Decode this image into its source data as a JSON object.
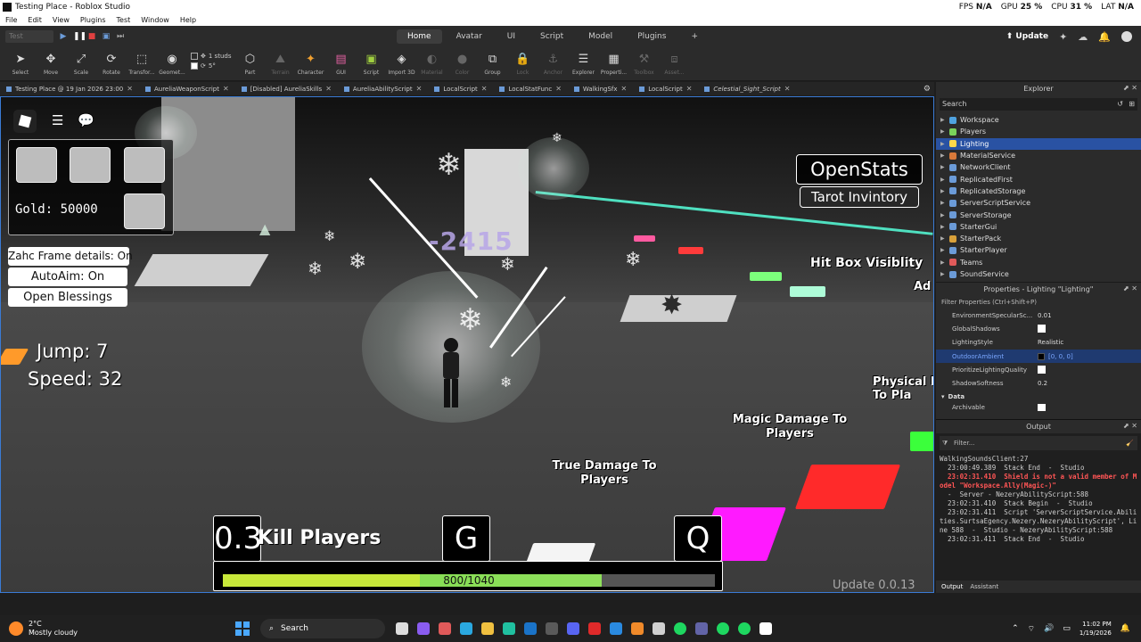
{
  "window": {
    "title": "Testing Place - Roblox Studio",
    "stats": [
      {
        "label": "FPS",
        "value": "N/A"
      },
      {
        "label": "GPU",
        "value": "25 %"
      },
      {
        "label": "CPU",
        "value": "31 %"
      },
      {
        "label": "LAT",
        "value": "N/A"
      }
    ]
  },
  "menu": [
    "File",
    "Edit",
    "View",
    "Plugins",
    "Test",
    "Window",
    "Help"
  ],
  "ribbon": {
    "test_select": "Test",
    "tabs": [
      {
        "label": "Home",
        "active": true
      },
      {
        "label": "Avatar",
        "active": false
      },
      {
        "label": "UI",
        "active": false
      },
      {
        "label": "Script",
        "active": false
      },
      {
        "label": "Model",
        "active": false
      },
      {
        "label": "Plugins",
        "active": false
      },
      {
        "label": "+",
        "active": false
      }
    ],
    "update_label": "Update"
  },
  "toolbar": {
    "tools": [
      {
        "label": "Select",
        "icon": "cursor-icon"
      },
      {
        "label": "Move",
        "icon": "move-icon"
      },
      {
        "label": "Scale",
        "icon": "scale-icon"
      },
      {
        "label": "Rotate",
        "icon": "rotate-icon"
      },
      {
        "label": "Transfor...",
        "icon": "transform-icon"
      },
      {
        "label": "Geomet...",
        "icon": "geometry-icon"
      }
    ],
    "snap_move": "1 studs",
    "snap_rotate": "5°",
    "tools2": [
      {
        "label": "Part",
        "icon": "part-icon",
        "dim": false
      },
      {
        "label": "Terrain",
        "icon": "terrain-icon",
        "dim": true
      },
      {
        "label": "Character",
        "icon": "character-icon",
        "dim": false
      },
      {
        "label": "GUI",
        "icon": "gui-icon",
        "dim": false
      },
      {
        "label": "Script",
        "icon": "script-icon",
        "dim": false
      },
      {
        "label": "Import 3D",
        "icon": "import3d-icon",
        "dim": false
      },
      {
        "label": "Material",
        "icon": "material-icon",
        "dim": true
      },
      {
        "label": "Color",
        "icon": "color-icon",
        "dim": true
      },
      {
        "label": "Group",
        "icon": "group-icon",
        "dim": false
      },
      {
        "label": "Lock",
        "icon": "lock-icon",
        "dim": true
      },
      {
        "label": "Anchor",
        "icon": "anchor-icon",
        "dim": true
      },
      {
        "label": "Explorer",
        "icon": "explorer-icon",
        "dim": false
      },
      {
        "label": "Properti...",
        "icon": "properties-icon",
        "dim": false
      },
      {
        "label": "Toolbox",
        "icon": "toolbox-icon",
        "dim": true
      },
      {
        "label": "Asset...",
        "icon": "asset-icon",
        "dim": true
      }
    ]
  },
  "script_tabs": [
    {
      "label": "Testing Place @ 19 Jan 2026 23:00",
      "italic": false
    },
    {
      "label": "AureliaWeaponScript",
      "italic": false
    },
    {
      "label": "[Disabled] AureliaSkills",
      "italic": false
    },
    {
      "label": "AureliaAbilityScript",
      "italic": false
    },
    {
      "label": "LocalScript",
      "italic": false
    },
    {
      "label": "LocalStatFunc",
      "italic": false
    },
    {
      "label": "WalkingSfx",
      "italic": false
    },
    {
      "label": "LocalScript",
      "italic": false
    },
    {
      "label": "Celestial_Sight_Script",
      "italic": true
    }
  ],
  "game": {
    "gold_label": "Gold:",
    "gold_value": "50000",
    "toggles": [
      "Zahc Frame details: On",
      "AutoAim: On",
      "Open Blessings"
    ],
    "jump": "Jump: 7",
    "speed": "Speed: 32",
    "open_stats": "OpenStats",
    "tarot": "Tarot Invintory",
    "damage_number": "-2415",
    "world_labels": {
      "hitbox": "Hit Box Visiblity",
      "ad": "Ad",
      "physical": "Physical D\nTo Pla",
      "magic": "Magic Damage To\nPlayers",
      "true_dmg": "True Damage To\nPlayers"
    },
    "cooldown": "0.3",
    "kill_text": "Kill Players",
    "key_g": "G",
    "key_q": "Q",
    "hp_text": "800/1040",
    "hp_current": 800,
    "hp_max": 1040,
    "update_version": "Update 0.0.13"
  },
  "explorer": {
    "title": "Explorer",
    "search_placeholder": "Search",
    "items": [
      {
        "label": "Workspace",
        "color": "#4fa3e0",
        "selected": false
      },
      {
        "label": "Players",
        "color": "#7ad35a",
        "selected": false
      },
      {
        "label": "Lighting",
        "color": "#ffd84a",
        "selected": true
      },
      {
        "label": "MaterialService",
        "color": "#d97a3a",
        "selected": false
      },
      {
        "label": "NetworkClient",
        "color": "#6b9bd8",
        "selected": false
      },
      {
        "label": "ReplicatedFirst",
        "color": "#6b9bd8",
        "selected": false
      },
      {
        "label": "ReplicatedStorage",
        "color": "#6b9bd8",
        "selected": false
      },
      {
        "label": "ServerScriptService",
        "color": "#6b9bd8",
        "selected": false
      },
      {
        "label": "ServerStorage",
        "color": "#6b9bd8",
        "selected": false
      },
      {
        "label": "StarterGui",
        "color": "#6b9bd8",
        "selected": false
      },
      {
        "label": "StarterPack",
        "color": "#d9a13a",
        "selected": false
      },
      {
        "label": "StarterPlayer",
        "color": "#6b9bd8",
        "selected": false
      },
      {
        "label": "Teams",
        "color": "#e05a5a",
        "selected": false
      },
      {
        "label": "SoundService",
        "color": "#6b9bd8",
        "selected": false
      }
    ]
  },
  "properties": {
    "title": "Properties - Lighting \"Lighting\"",
    "filter_placeholder": "Filter Properties (Ctrl+Shift+P)",
    "rows": [
      {
        "name": "EnvironmentSpecularSc...",
        "value": "0.01",
        "type": "text"
      },
      {
        "name": "GlobalShadows",
        "value": "",
        "type": "check"
      },
      {
        "name": "LightingStyle",
        "value": "Realistic",
        "type": "text"
      },
      {
        "name": "OutdoorAmbient",
        "value": "[0, 0, 0]",
        "type": "color",
        "selected": true
      },
      {
        "name": "PrioritizeLightingQuality",
        "value": "",
        "type": "check"
      },
      {
        "name": "ShadowSoftness",
        "value": "0.2",
        "type": "text"
      }
    ],
    "section": "Data",
    "archivable": "Archivable"
  },
  "output": {
    "title": "Output",
    "filter_placeholder": "Filter...",
    "lines": [
      {
        "text": "WalkingSoundsClient:27",
        "err": false
      },
      {
        "text": "  23:00:49.389  Stack End  -  Studio",
        "err": false
      },
      {
        "text": "  23:02:31.410  Shield is not a valid member of Model \"Workspace.Ally(Magic-)\"",
        "err": true
      },
      {
        "text": "  -  Server - NezeryAbilityScript:588",
        "err": false
      },
      {
        "text": "  23:02:31.410  Stack Begin  -  Studio",
        "err": false
      },
      {
        "text": "  23:02:31.411  Script 'ServerScriptService.Abilities.SurtsaEgency.Nezery.NezeryAbilityScript', Line 588  -  Studio - NezeryAbilityScript:588",
        "err": false
      },
      {
        "text": "  23:02:31.411  Stack End  -  Studio",
        "err": false
      }
    ],
    "tabs": [
      "Output",
      "Assistant"
    ]
  },
  "taskbar": {
    "temp": "2°C",
    "weather": "Mostly cloudy",
    "search": "Search",
    "time": "11:02 PM",
    "date": "1/19/2026"
  }
}
